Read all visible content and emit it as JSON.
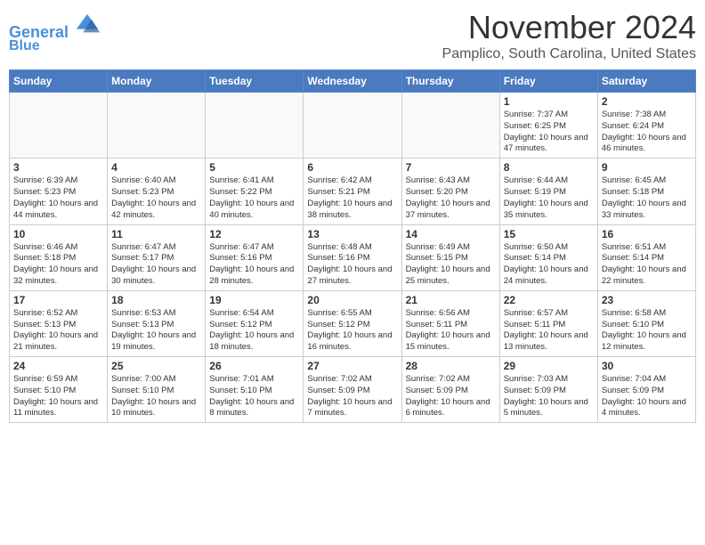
{
  "logo": {
    "line1": "General",
    "line2": "Blue"
  },
  "title": "November 2024",
  "location": "Pamplico, South Carolina, United States",
  "weekdays": [
    "Sunday",
    "Monday",
    "Tuesday",
    "Wednesday",
    "Thursday",
    "Friday",
    "Saturday"
  ],
  "weeks": [
    [
      {
        "day": "",
        "info": ""
      },
      {
        "day": "",
        "info": ""
      },
      {
        "day": "",
        "info": ""
      },
      {
        "day": "",
        "info": ""
      },
      {
        "day": "",
        "info": ""
      },
      {
        "day": "1",
        "info": "Sunrise: 7:37 AM\nSunset: 6:25 PM\nDaylight: 10 hours and 47 minutes."
      },
      {
        "day": "2",
        "info": "Sunrise: 7:38 AM\nSunset: 6:24 PM\nDaylight: 10 hours and 46 minutes."
      }
    ],
    [
      {
        "day": "3",
        "info": "Sunrise: 6:39 AM\nSunset: 5:23 PM\nDaylight: 10 hours and 44 minutes."
      },
      {
        "day": "4",
        "info": "Sunrise: 6:40 AM\nSunset: 5:23 PM\nDaylight: 10 hours and 42 minutes."
      },
      {
        "day": "5",
        "info": "Sunrise: 6:41 AM\nSunset: 5:22 PM\nDaylight: 10 hours and 40 minutes."
      },
      {
        "day": "6",
        "info": "Sunrise: 6:42 AM\nSunset: 5:21 PM\nDaylight: 10 hours and 38 minutes."
      },
      {
        "day": "7",
        "info": "Sunrise: 6:43 AM\nSunset: 5:20 PM\nDaylight: 10 hours and 37 minutes."
      },
      {
        "day": "8",
        "info": "Sunrise: 6:44 AM\nSunset: 5:19 PM\nDaylight: 10 hours and 35 minutes."
      },
      {
        "day": "9",
        "info": "Sunrise: 6:45 AM\nSunset: 5:18 PM\nDaylight: 10 hours and 33 minutes."
      }
    ],
    [
      {
        "day": "10",
        "info": "Sunrise: 6:46 AM\nSunset: 5:18 PM\nDaylight: 10 hours and 32 minutes."
      },
      {
        "day": "11",
        "info": "Sunrise: 6:47 AM\nSunset: 5:17 PM\nDaylight: 10 hours and 30 minutes."
      },
      {
        "day": "12",
        "info": "Sunrise: 6:47 AM\nSunset: 5:16 PM\nDaylight: 10 hours and 28 minutes."
      },
      {
        "day": "13",
        "info": "Sunrise: 6:48 AM\nSunset: 5:16 PM\nDaylight: 10 hours and 27 minutes."
      },
      {
        "day": "14",
        "info": "Sunrise: 6:49 AM\nSunset: 5:15 PM\nDaylight: 10 hours and 25 minutes."
      },
      {
        "day": "15",
        "info": "Sunrise: 6:50 AM\nSunset: 5:14 PM\nDaylight: 10 hours and 24 minutes."
      },
      {
        "day": "16",
        "info": "Sunrise: 6:51 AM\nSunset: 5:14 PM\nDaylight: 10 hours and 22 minutes."
      }
    ],
    [
      {
        "day": "17",
        "info": "Sunrise: 6:52 AM\nSunset: 5:13 PM\nDaylight: 10 hours and 21 minutes."
      },
      {
        "day": "18",
        "info": "Sunrise: 6:53 AM\nSunset: 5:13 PM\nDaylight: 10 hours and 19 minutes."
      },
      {
        "day": "19",
        "info": "Sunrise: 6:54 AM\nSunset: 5:12 PM\nDaylight: 10 hours and 18 minutes."
      },
      {
        "day": "20",
        "info": "Sunrise: 6:55 AM\nSunset: 5:12 PM\nDaylight: 10 hours and 16 minutes."
      },
      {
        "day": "21",
        "info": "Sunrise: 6:56 AM\nSunset: 5:11 PM\nDaylight: 10 hours and 15 minutes."
      },
      {
        "day": "22",
        "info": "Sunrise: 6:57 AM\nSunset: 5:11 PM\nDaylight: 10 hours and 13 minutes."
      },
      {
        "day": "23",
        "info": "Sunrise: 6:58 AM\nSunset: 5:10 PM\nDaylight: 10 hours and 12 minutes."
      }
    ],
    [
      {
        "day": "24",
        "info": "Sunrise: 6:59 AM\nSunset: 5:10 PM\nDaylight: 10 hours and 11 minutes."
      },
      {
        "day": "25",
        "info": "Sunrise: 7:00 AM\nSunset: 5:10 PM\nDaylight: 10 hours and 10 minutes."
      },
      {
        "day": "26",
        "info": "Sunrise: 7:01 AM\nSunset: 5:10 PM\nDaylight: 10 hours and 8 minutes."
      },
      {
        "day": "27",
        "info": "Sunrise: 7:02 AM\nSunset: 5:09 PM\nDaylight: 10 hours and 7 minutes."
      },
      {
        "day": "28",
        "info": "Sunrise: 7:02 AM\nSunset: 5:09 PM\nDaylight: 10 hours and 6 minutes."
      },
      {
        "day": "29",
        "info": "Sunrise: 7:03 AM\nSunset: 5:09 PM\nDaylight: 10 hours and 5 minutes."
      },
      {
        "day": "30",
        "info": "Sunrise: 7:04 AM\nSunset: 5:09 PM\nDaylight: 10 hours and 4 minutes."
      }
    ]
  ]
}
